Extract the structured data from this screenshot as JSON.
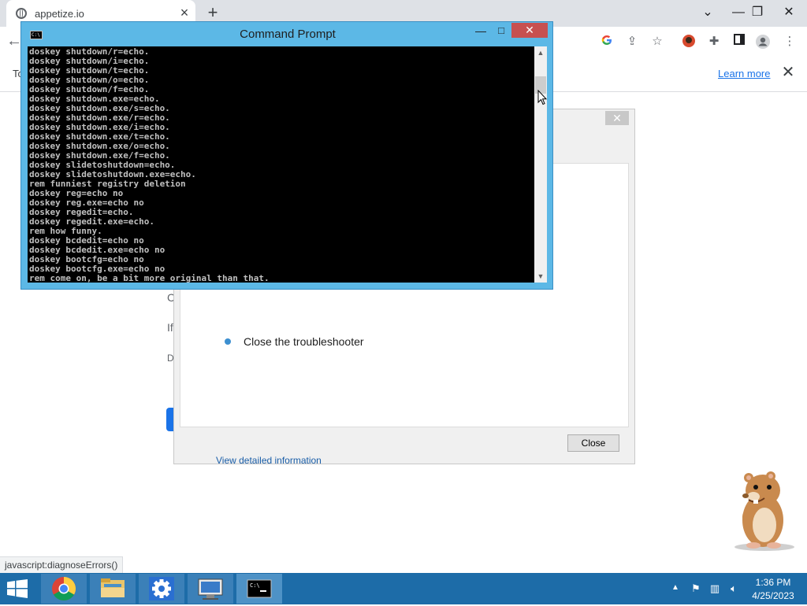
{
  "browser": {
    "tab_title": "appetize.io",
    "tab_close": "×",
    "new_tab": "+",
    "controls": {
      "chevron": "⌄",
      "minimize": "—",
      "restore": "❐",
      "close": "✕"
    },
    "back": "←",
    "infobar": {
      "text": "To",
      "learn_more": "Learn more",
      "close": "✕"
    },
    "toolbar_icons": [
      "google-g",
      "share",
      "star",
      "profile-avatar",
      "extensions",
      "side-panel",
      "account",
      "more"
    ]
  },
  "page": {
    "fragments": [
      "C",
      "If",
      "D"
    ],
    "status_url": "javascript:diagnoseErrors()"
  },
  "troubleshooter": {
    "item_text": "Close the troubleshooter",
    "view_detailed": "View detailed information",
    "close_button": "Close"
  },
  "cmd": {
    "title": "Command Prompt",
    "icon_text": "C:\\",
    "minimize": "—",
    "maximize": "□",
    "close": "✕",
    "lines": [
      "doskey shutdown/r=echo.",
      "doskey shutdown/i=echo.",
      "doskey shutdown/t=echo.",
      "doskey shutdown/o=echo.",
      "doskey shutdown/f=echo.",
      "doskey shutdown.exe=echo.",
      "doskey shutdown.exe/s=echo.",
      "doskey shutdown.exe/r=echo.",
      "doskey shutdown.exe/i=echo.",
      "doskey shutdown.exe/t=echo.",
      "doskey shutdown.exe/o=echo.",
      "doskey shutdown.exe/f=echo.",
      "doskey slidetoshutdown=echo.",
      "doskey slidetoshutdown.exe=echo.",
      "rem funniest registry deletion",
      "doskey reg=echo no",
      "doskey reg.exe=echo no",
      "doskey regedit=echo.",
      "doskey regedit.exe=echo.",
      "rem how funny.",
      "doskey bcdedit=echo no",
      "doskey bcdedit.exe=echo no",
      "doskey bootcfg=echo no",
      "doskey bootcfg.exe=echo no",
      "rem come on, be a bit more original than that."
    ],
    "scroll_up": "▲",
    "scroll_down": "▼"
  },
  "taskbar": {
    "items": [
      "start",
      "chrome",
      "file-explorer",
      "settings",
      "remote-desktop",
      "command-prompt"
    ],
    "active": "command-prompt",
    "clock_time": "1:36 PM",
    "clock_date": "4/25/2023"
  },
  "colors": {
    "cmd_frame": "#5cb8e6",
    "cmd_close": "#c75050",
    "taskbar": "#1d6ca8",
    "link": "#1a73e8"
  }
}
